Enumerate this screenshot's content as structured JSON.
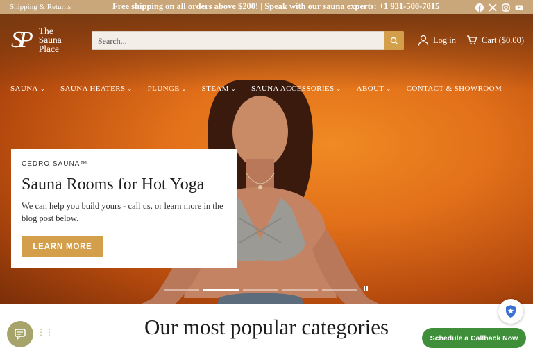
{
  "announcement": {
    "left_link": "Shipping & Returns",
    "message": "Free shipping on all orders above $200! | Speak with our sauna experts: ",
    "phone": "+1 931-500-7015",
    "social_icons": [
      "facebook-icon",
      "x-icon",
      "instagram-icon",
      "youtube-icon"
    ]
  },
  "header": {
    "logo_mark": "SP",
    "logo_line1": "The",
    "logo_line2": "Sauna",
    "logo_line3": "Place",
    "search_placeholder": "Search...",
    "login_label": "Log in",
    "cart_label": "Cart ($0.00)"
  },
  "nav": {
    "items": [
      {
        "label": "SAUNA",
        "dropdown": true
      },
      {
        "label": "SAUNA HEATERS",
        "dropdown": true
      },
      {
        "label": "PLUNGE",
        "dropdown": true
      },
      {
        "label": "STEAM",
        "dropdown": true
      },
      {
        "label": "SAUNA ACCESSORIES",
        "dropdown": true
      },
      {
        "label": "ABOUT",
        "dropdown": true
      },
      {
        "label": "CONTACT & SHOWROOM",
        "dropdown": false
      }
    ]
  },
  "hero": {
    "eyebrow": "CEDRO SAUNA™",
    "title": "Sauna Rooms for Hot Yoga",
    "description": "We can help you build yours - call us, or learn more in the blog post below.",
    "cta_label": "LEARN MORE",
    "slides_total": 5,
    "active_slide": 2
  },
  "categories": {
    "title": "Our most popular categories"
  },
  "widgets": {
    "callback_label": "Schedule a Callback Now"
  },
  "colors": {
    "accent": "#d49f4a",
    "topbar": "#c9a77a",
    "callback_green": "#3f8f3a"
  }
}
